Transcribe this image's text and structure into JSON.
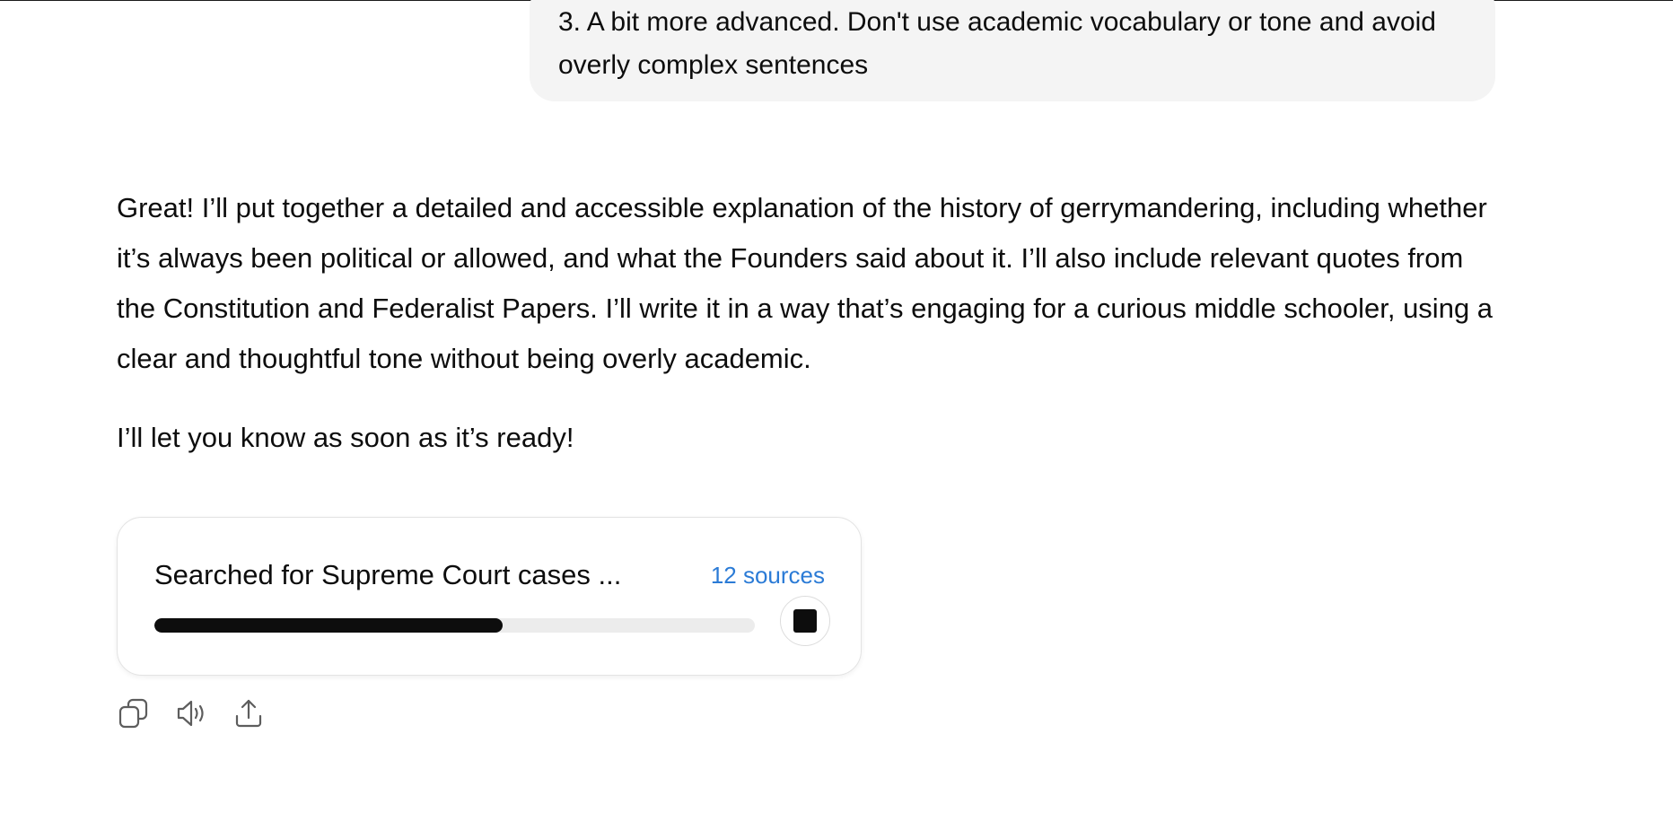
{
  "user_message": {
    "text": "3. A bit more advanced. Don't use academic vocabulary or tone and avoid overly complex sentences"
  },
  "assistant_message": {
    "paragraphs": [
      "Great! I’ll put together a detailed and accessible explanation of the history of gerrymandering, including whether it’s always been political or allowed, and what the Founders said about it. I’ll also include relevant quotes from the Constitution and Federalist Papers. I’ll write it in a way that’s engaging for a curious middle schooler, using a clear and thoughtful tone without being overly academic.",
      "I’ll let you know as soon as it’s ready!"
    ]
  },
  "research_card": {
    "status_text": "Searched for Supreme Court cases ...",
    "sources_label": "12 sources",
    "progress_fraction": 0.58
  },
  "actions": {
    "icons": [
      "copy-icon",
      "read-aloud-icon",
      "share-icon"
    ]
  },
  "colors": {
    "bubble_bg": "#f4f4f4",
    "link_blue": "#2b7bd6",
    "text": "#0d0d0d",
    "progress_track": "#ececec"
  }
}
